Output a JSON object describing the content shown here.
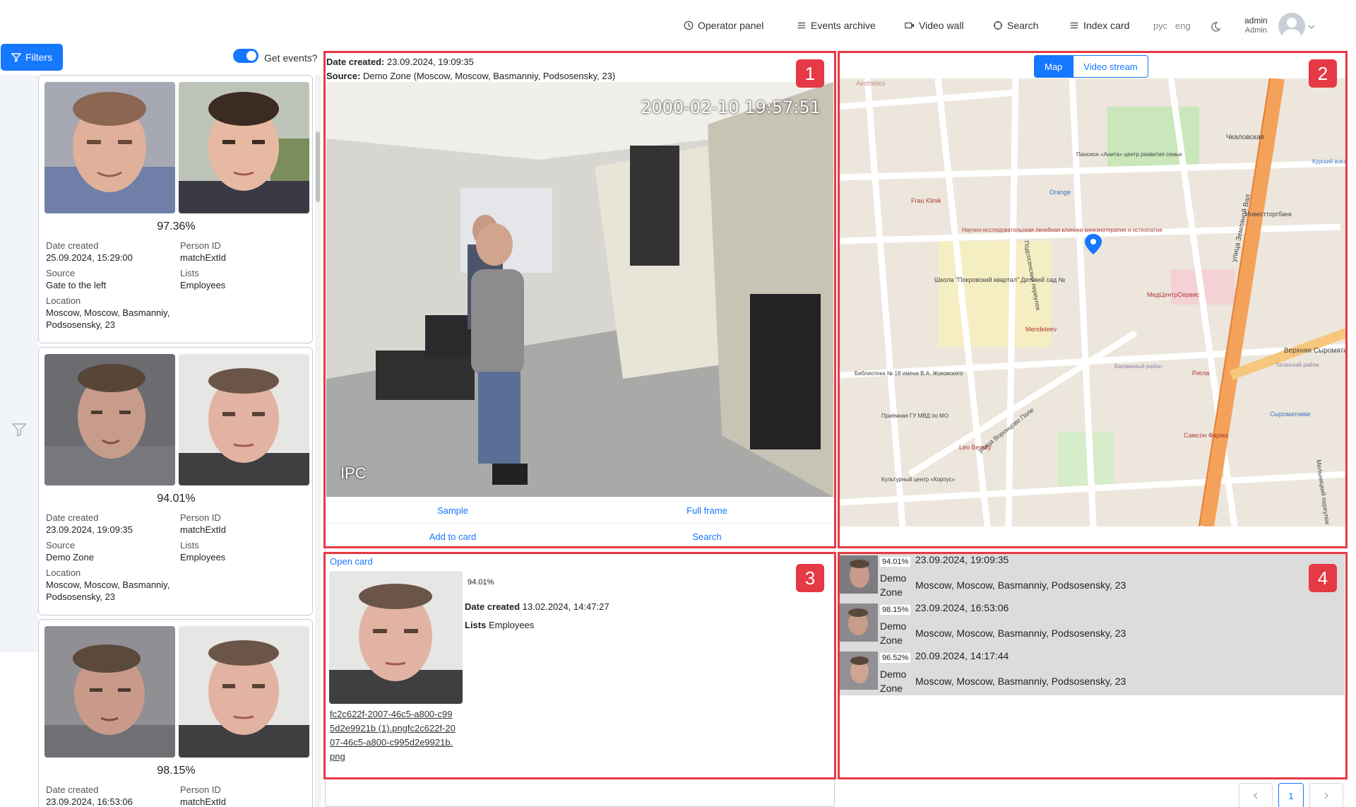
{
  "nav": {
    "items": [
      {
        "label": "Operator panel",
        "icon": "clock-icon"
      },
      {
        "label": "Events archive",
        "icon": "list-icon"
      },
      {
        "label": "Video wall",
        "icon": "video-camera-icon"
      },
      {
        "label": "Search",
        "icon": "search-target-icon"
      },
      {
        "label": "Index card",
        "icon": "list-icon"
      }
    ],
    "lang_ru": "рус",
    "lang_en": "eng",
    "theme_icon": "moon-icon",
    "user_name": "admin",
    "user_role": "Admin"
  },
  "left": {
    "filters_label": "Filters",
    "get_events_label": "Get events?",
    "get_events_on": true,
    "labels": {
      "date_created": "Date created",
      "person_id": "Person ID",
      "source": "Source",
      "lists": "Lists",
      "location": "Location"
    },
    "cards": [
      {
        "percent": "97.36%",
        "date": "25.09.2024, 15:29:00",
        "person_id": "matchExtId",
        "source": "Gate to the left",
        "lists": "Employees",
        "location": "Moscow, Moscow, Basmanniy, Podsosensky, 23"
      },
      {
        "percent": "94.01%",
        "date": "23.09.2024, 19:09:35",
        "person_id": "matchExtId",
        "source": "Demo Zone",
        "lists": "Employees",
        "location": "Moscow, Moscow, Basmanniy, Podsosensky, 23"
      },
      {
        "percent": "98.15%",
        "date": "23.09.2024, 16:53:06",
        "person_id": "matchExtId",
        "source": "",
        "lists": "",
        "location": ""
      }
    ]
  },
  "panel1": {
    "badge": "1",
    "date_label": "Date created",
    "date_value": "23.09.2024, 19:09:35",
    "source_label": "Source",
    "source_value": "Demo Zone (Moscow, Moscow, Basmanniy, Podsosensky, 23)",
    "video_timestamp": "2000-02-10 19:57:51",
    "video_overlay": "IPC",
    "buttons": {
      "sample": "Sample",
      "full_frame": "Full frame",
      "add_to_card": "Add to card",
      "search": "Search"
    }
  },
  "panel2": {
    "badge": "2",
    "tab_map": "Map",
    "tab_video": "Video stream",
    "map_labels": {
      "l1": "Aesthetics",
      "l2": "Чкаловская",
      "l3": "Пансион «Анита» центр развития семьи",
      "l4": "Orange",
      "l5": "Frau Klinik",
      "l6": "Научно-исследовательская лечебная клиника кинезиотерапии и остеопатии",
      "l7": "Школа \"Покровский квартал\" Детский сад №",
      "l8": "МедЦентрСервис",
      "l9": "Mendeleev",
      "l10": "Библиотека № 18 имени В.А. Жуковского",
      "l11": "Подсосенский переулок",
      "l12": "улица Воронцово Поле",
      "l13": "улица Земляной Вал",
      "l14": "Верхняя Сыромятническая",
      "l15": "Ригла",
      "l16": "Leo Beauty",
      "l17": "Культурный центр «Корпус»",
      "l18": "Приёмная ГУ МВД по МО",
      "l19": "Самсон Фарма",
      "l20": "Мельницкий переулок",
      "l21": "Инвестторгбанк",
      "l22": "Курский вокзал",
      "l23": "Сыроматники",
      "l24": "Таганский район",
      "l25": "Басманный район"
    }
  },
  "panel3": {
    "badge": "3",
    "open_card": "Open card",
    "percent": "94.01%",
    "date_label": "Date created",
    "date_value": "13.02.2024, 14:47:27",
    "lists_label": "Lists",
    "lists_value": "Employees",
    "file_name": "fc2c622f-2007-46c5-a800-c995d2e9921b (1).pngfc2c622f-2007-46c5-a800-c995d2e9921b.png"
  },
  "panel4": {
    "badge": "4",
    "rows": [
      {
        "percent": "94.01%",
        "date": "23.09.2024, 19:09:35",
        "source": "Demo Zone",
        "location": "Moscow, Moscow, Basmanniy, Podsosensky, 23"
      },
      {
        "percent": "98.15%",
        "date": "23.09.2024, 16:53:06",
        "source": "Demo Zone",
        "location": "Moscow, Moscow, Basmanniy, Podsosensky, 23"
      },
      {
        "percent": "96.52%",
        "date": "20.09.2024, 14:17:44",
        "source": "Demo Zone",
        "location": "Moscow, Moscow, Basmanniy, Podsosensky, 23"
      }
    ],
    "page": "1",
    "prev_icon": "chevron-left-icon",
    "next_icon": "chevron-right-icon"
  },
  "colors": {
    "accent": "#1677ff",
    "highlight": "#e53945",
    "map_road": "#f4a25a"
  }
}
